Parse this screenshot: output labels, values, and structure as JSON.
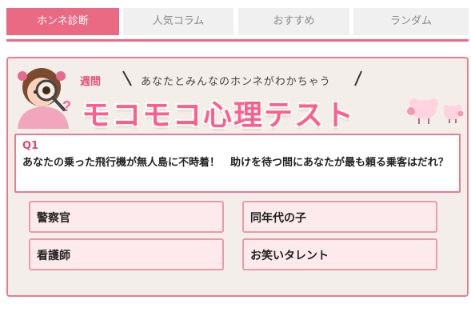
{
  "tabs": [
    {
      "label": "ホンネ診断",
      "active": true
    },
    {
      "label": "人気コラム",
      "active": false
    },
    {
      "label": "おすすめ",
      "active": false
    },
    {
      "label": "ランダム",
      "active": false
    }
  ],
  "banner": {
    "weekly_label": "週間",
    "subtitle": "あなたとみんなのホンネがわかちゃう",
    "title": "モコモコ心理テスト"
  },
  "question": {
    "number": "Q1",
    "text": "あなたの乗った飛行機が無人島に不時着！　助けを待つ間にあなたが最も頼る乗客はだれ？"
  },
  "answers": [
    {
      "label": "警察官"
    },
    {
      "label": "同年代の子"
    },
    {
      "label": "看護師"
    },
    {
      "label": "お笑いタレント"
    }
  ],
  "colors": {
    "accent": "#ea6a84",
    "panel_bg": "#f4eeea",
    "answer_bg": "#fdeaec",
    "title_pink": "#ff5e8c"
  }
}
